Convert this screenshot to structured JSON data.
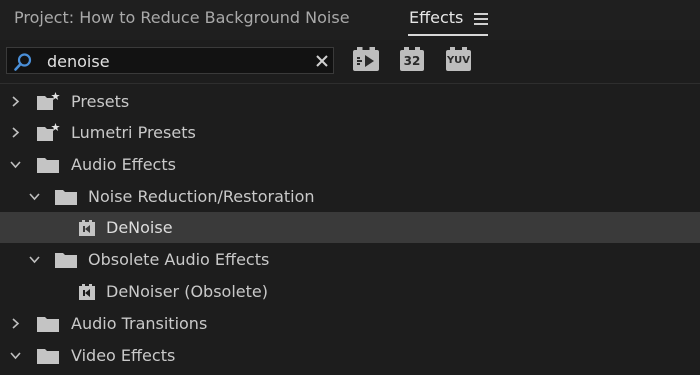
{
  "header": {
    "project_tab": "Project: How to Reduce Background Noise",
    "effects_tab": "Effects"
  },
  "search": {
    "value": "denoise",
    "placeholder": ""
  },
  "filters": {
    "accelerated_label": "",
    "bit32_label": "32",
    "yuv_label": "YUV"
  },
  "tree": {
    "items": [
      {
        "label": "Presets",
        "type": "folder-star",
        "expanded": false
      },
      {
        "label": "Lumetri Presets",
        "type": "folder-star",
        "expanded": false
      },
      {
        "label": "Audio Effects",
        "type": "folder",
        "expanded": true
      },
      {
        "label": "Noise Reduction/Restoration",
        "type": "folder",
        "expanded": true
      },
      {
        "label": "DeNoise",
        "type": "effect",
        "selected": true
      },
      {
        "label": "Obsolete Audio Effects",
        "type": "folder",
        "expanded": true
      },
      {
        "label": "DeNoiser (Obsolete)",
        "type": "effect"
      },
      {
        "label": "Audio Transitions",
        "type": "folder",
        "expanded": false
      },
      {
        "label": "Video Effects",
        "type": "folder",
        "expanded": true
      }
    ]
  },
  "colors": {
    "background": "#1d1d1d",
    "selected_row": "#3a3a3a",
    "search_icon": "#4a8fd8"
  }
}
